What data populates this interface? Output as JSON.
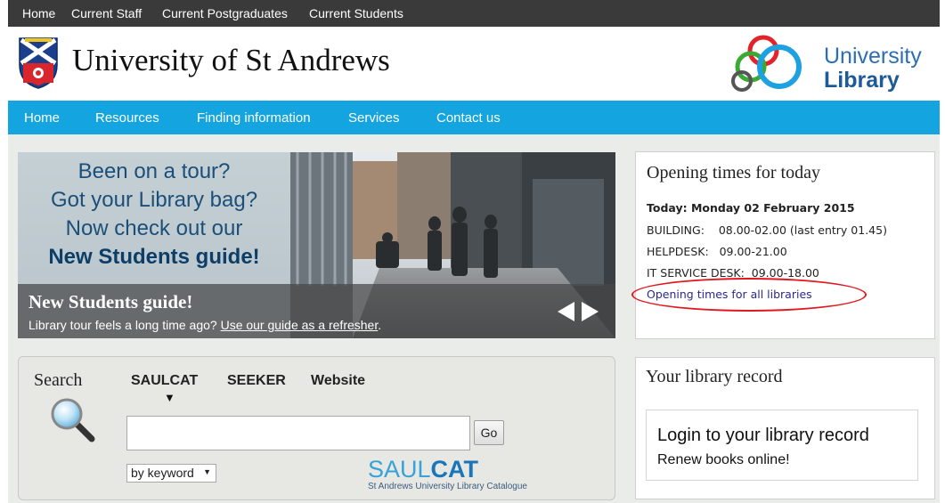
{
  "topbar": {
    "items": [
      "Home",
      "Current Staff",
      "Current Postgraduates",
      "Current Students"
    ]
  },
  "header": {
    "university_name": "University of St Andrews",
    "library_logo_line1": "University",
    "library_logo_line2": "Library"
  },
  "nav": {
    "items": [
      "Home",
      "Resources",
      "Finding information",
      "Services",
      "Contact us"
    ]
  },
  "banner": {
    "promo_lines": [
      "Been on a tour?",
      "Got your Library bag?",
      "Now check out our"
    ],
    "promo_strong": "New Students guide!",
    "caption_title": "New Students guide!",
    "caption_text": "Library tour feels a long time ago?",
    "caption_link": "Use our guide as a refresher",
    "caption_end": "."
  },
  "search": {
    "title": "Search",
    "tabs": [
      "SAULCAT",
      "SEEKER",
      "Website"
    ],
    "active_tab_marker": "▼",
    "input_value": "",
    "go_label": "Go",
    "select_value": "by keyword",
    "saulcat_logo_light": "SAUL",
    "saulcat_logo_bold": "CAT",
    "saulcat_subtitle": "St Andrews University Library Catalogue"
  },
  "opening": {
    "title": "Opening times for today",
    "date_line": "Today: Monday 02 February 2015",
    "building": "BUILDING:    08.00-02.00 (last entry 01.45)",
    "helpdesk": "HELPDESK:   09.00-21.00",
    "it_service": "IT SERVICE DESK:  09.00-18.00",
    "link": "Opening times for all libraries"
  },
  "record": {
    "title": "Your library record",
    "login": "Login to your library record",
    "renew": "Renew books online!"
  },
  "colors": {
    "topbar": "#3a3a3a",
    "nav": "#14a5e0",
    "content_bg": "#eaecea",
    "link": "#2a2a8a",
    "annotation": "#e1171f"
  },
  "icons": {
    "crest": "university-crest-icon",
    "library_logo": "library-rings-logo-icon",
    "search": "magnifier-icon",
    "prev": "arrow-left-icon",
    "next": "arrow-right-icon"
  }
}
